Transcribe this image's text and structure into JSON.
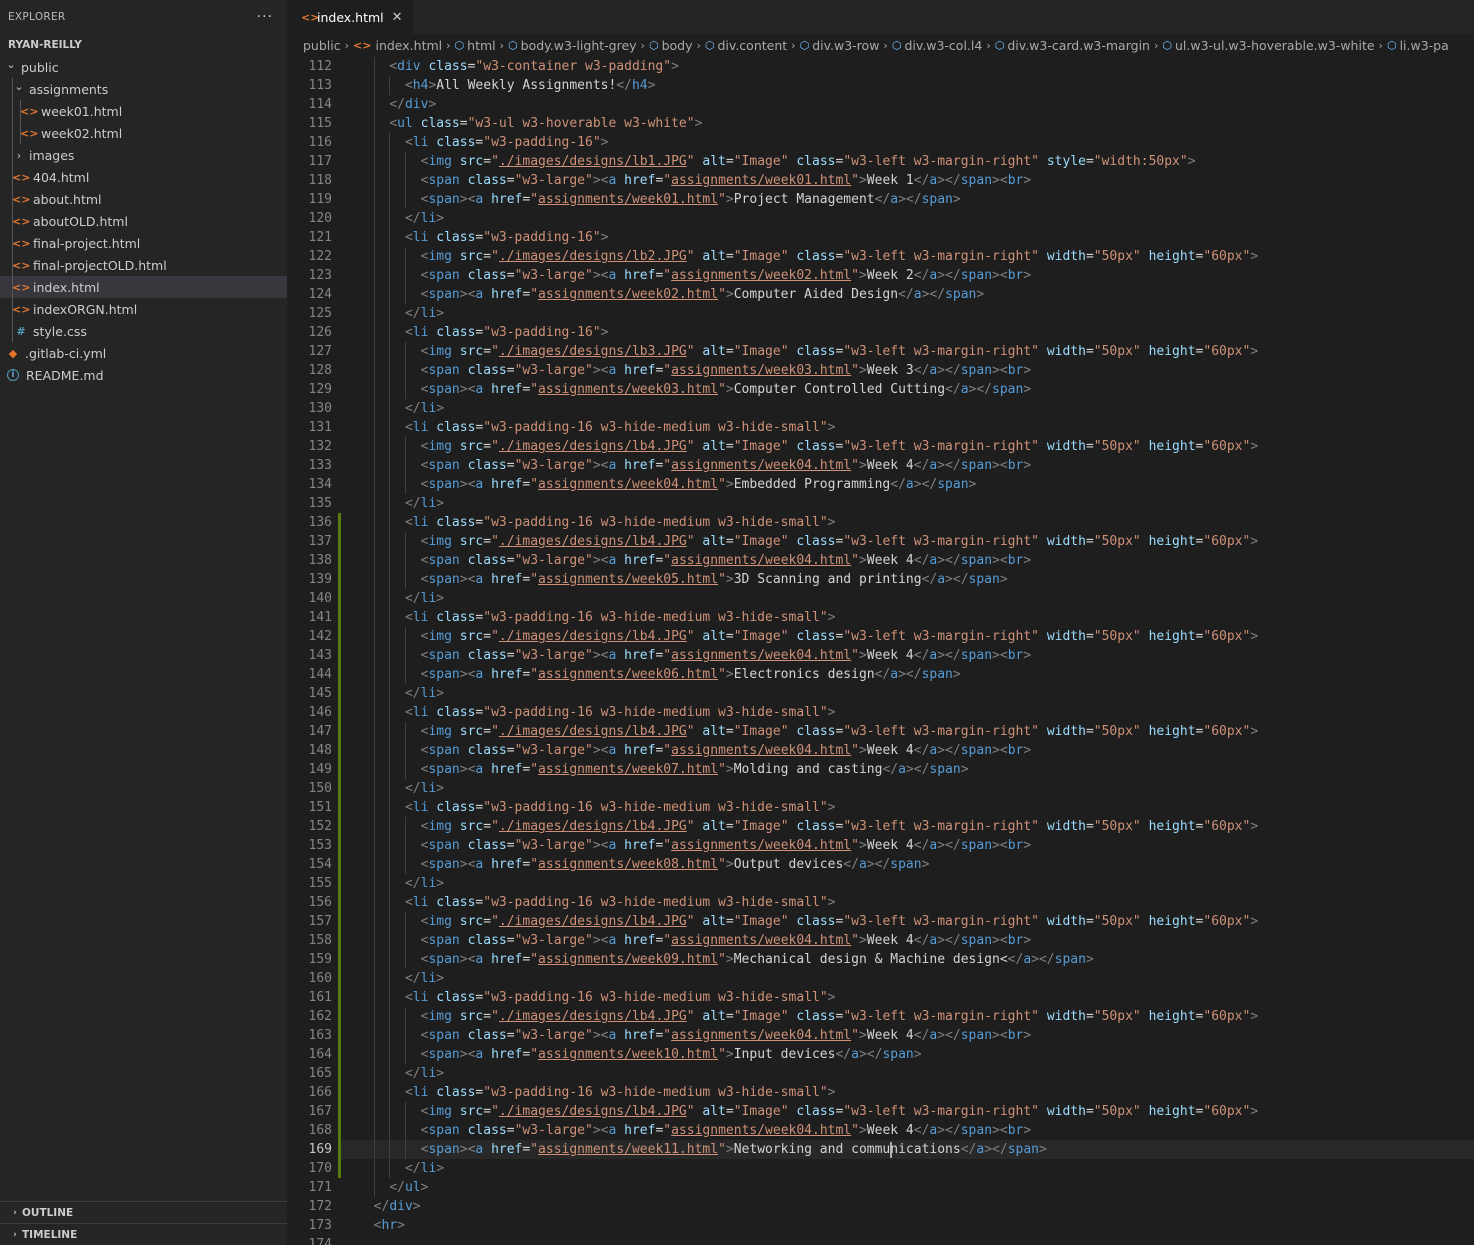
{
  "explorer": {
    "title": "EXPLORER",
    "more": "···",
    "root": "RYAN-REILLY",
    "tree": [
      {
        "label": "public",
        "kind": "folder-open",
        "depth": 0
      },
      {
        "label": "assignments",
        "kind": "folder-open",
        "depth": 1
      },
      {
        "label": "week01.html",
        "kind": "html",
        "depth": 2
      },
      {
        "label": "week02.html",
        "kind": "html",
        "depth": 2
      },
      {
        "label": "images",
        "kind": "folder-closed",
        "depth": 1
      },
      {
        "label": "404.html",
        "kind": "html",
        "depth": 1
      },
      {
        "label": "about.html",
        "kind": "html",
        "depth": 1
      },
      {
        "label": "aboutOLD.html",
        "kind": "html",
        "depth": 1
      },
      {
        "label": "final-project.html",
        "kind": "html",
        "depth": 1
      },
      {
        "label": "final-projectOLD.html",
        "kind": "html",
        "depth": 1
      },
      {
        "label": "index.html",
        "kind": "html",
        "depth": 1,
        "selected": true
      },
      {
        "label": "indexORGN.html",
        "kind": "html",
        "depth": 1
      },
      {
        "label": "style.css",
        "kind": "css",
        "depth": 1
      },
      {
        "label": ".gitlab-ci.yml",
        "kind": "yml",
        "depth": 0
      },
      {
        "label": "README.md",
        "kind": "info",
        "depth": 0
      }
    ],
    "outline": "OUTLINE",
    "timeline": "TIMELINE"
  },
  "tab": {
    "label": "index.html",
    "close": "✕"
  },
  "breadcrumb": [
    {
      "label": "public",
      "icon": "none"
    },
    {
      "label": "index.html",
      "icon": "html"
    },
    {
      "label": "html",
      "icon": "cube"
    },
    {
      "label": "body.w3-light-grey",
      "icon": "cube"
    },
    {
      "label": "body",
      "icon": "cube"
    },
    {
      "label": "div.content",
      "icon": "cube"
    },
    {
      "label": "div.w3-row",
      "icon": "cube"
    },
    {
      "label": "div.w3-col.l4",
      "icon": "cube"
    },
    {
      "label": "div.w3-card.w3-margin",
      "icon": "cube"
    },
    {
      "label": "ul.w3-ul.w3-hoverable.w3-white",
      "icon": "cube"
    },
    {
      "label": "li.w3-pa",
      "icon": "cube"
    }
  ],
  "editor": {
    "current_line": 169,
    "lines": [
      {
        "n": "112",
        "code": "    <div class=\"w3-container w3-padding\">"
      },
      {
        "n": "113",
        "code": "      <h4>All Weekly Assignments!</h4>"
      },
      {
        "n": "114",
        "code": "    </div>"
      },
      {
        "n": "115",
        "code": "    <ul class=\"w3-ul w3-hoverable w3-white\">"
      },
      {
        "n": "116",
        "code": "      <li class=\"w3-padding-16\">"
      },
      {
        "n": "117",
        "code": "        <img src=\"./images/designs/lb1.JPG\" alt=\"Image\" class=\"w3-left w3-margin-right\" style=\"width:50px\">"
      },
      {
        "n": "118",
        "code": "        <span class=\"w3-large\"><a href=\"assignments/week01.html\">Week 1</a></span><br>"
      },
      {
        "n": "119",
        "code": "        <span><a href=\"assignments/week01.html\">Project Management</a></span>"
      },
      {
        "n": "120",
        "code": "      </li>"
      },
      {
        "n": "121",
        "code": "      <li class=\"w3-padding-16\">"
      },
      {
        "n": "122",
        "code": "        <img src=\"./images/designs/lb2.JPG\" alt=\"Image\" class=\"w3-left w3-margin-right\" width=\"50px\" height=\"60px\">"
      },
      {
        "n": "123",
        "code": "        <span class=\"w3-large\"><a href=\"assignments/week02.html\">Week 2</a></span><br>"
      },
      {
        "n": "124",
        "code": "        <span><a href=\"assignments/week02.html\">Computer Aided Design</a></span>"
      },
      {
        "n": "125",
        "code": "      </li>"
      },
      {
        "n": "126",
        "code": "      <li class=\"w3-padding-16\">"
      },
      {
        "n": "127",
        "code": "        <img src=\"./images/designs/lb3.JPG\" alt=\"Image\" class=\"w3-left w3-margin-right\" width=\"50px\" height=\"60px\">"
      },
      {
        "n": "128",
        "code": "        <span class=\"w3-large\"><a href=\"assignments/week03.html\">Week 3</a></span><br>"
      },
      {
        "n": "129",
        "code": "        <span><a href=\"assignments/week03.html\">Computer Controlled Cutting</a></span>"
      },
      {
        "n": "130",
        "code": "      </li>"
      },
      {
        "n": "131",
        "code": "      <li class=\"w3-padding-16 w3-hide-medium w3-hide-small\">"
      },
      {
        "n": "132",
        "code": "        <img src=\"./images/designs/lb4.JPG\" alt=\"Image\" class=\"w3-left w3-margin-right\" width=\"50px\" height=\"60px\">"
      },
      {
        "n": "133",
        "code": "        <span class=\"w3-large\"><a href=\"assignments/week04.html\">Week 4</a></span><br>"
      },
      {
        "n": "134",
        "code": "        <span><a href=\"assignments/week04.html\">Embedded Programming</a></span>"
      },
      {
        "n": "135",
        "code": "      </li>"
      },
      {
        "n": "136",
        "code": "      <li class=\"w3-padding-16 w3-hide-medium w3-hide-small\">",
        "mod": true
      },
      {
        "n": "137",
        "code": "        <img src=\"./images/designs/lb4.JPG\" alt=\"Image\" class=\"w3-left w3-margin-right\" width=\"50px\" height=\"60px\">",
        "mod": true
      },
      {
        "n": "138",
        "code": "        <span class=\"w3-large\"><a href=\"assignments/week04.html\">Week 4</a></span><br>",
        "mod": true
      },
      {
        "n": "139",
        "code": "        <span><a href=\"assignments/week05.html\">3D Scanning and printing</a></span>",
        "mod": true
      },
      {
        "n": "140",
        "code": "      </li>",
        "mod": true
      },
      {
        "n": "141",
        "code": "      <li class=\"w3-padding-16 w3-hide-medium w3-hide-small\">",
        "mod": true
      },
      {
        "n": "142",
        "code": "        <img src=\"./images/designs/lb4.JPG\" alt=\"Image\" class=\"w3-left w3-margin-right\" width=\"50px\" height=\"60px\">",
        "mod": true
      },
      {
        "n": "143",
        "code": "        <span class=\"w3-large\"><a href=\"assignments/week04.html\">Week 4</a></span><br>",
        "mod": true
      },
      {
        "n": "144",
        "code": "        <span><a href=\"assignments/week06.html\">Electronics design</a></span>",
        "mod": true
      },
      {
        "n": "145",
        "code": "      </li>",
        "mod": true
      },
      {
        "n": "146",
        "code": "      <li class=\"w3-padding-16 w3-hide-medium w3-hide-small\">",
        "mod": true
      },
      {
        "n": "147",
        "code": "        <img src=\"./images/designs/lb4.JPG\" alt=\"Image\" class=\"w3-left w3-margin-right\" width=\"50px\" height=\"60px\">",
        "mod": true
      },
      {
        "n": "148",
        "code": "        <span class=\"w3-large\"><a href=\"assignments/week04.html\">Week 4</a></span><br>",
        "mod": true
      },
      {
        "n": "149",
        "code": "        <span><a href=\"assignments/week07.html\">Molding and casting</a></span>",
        "mod": true
      },
      {
        "n": "150",
        "code": "      </li>",
        "mod": true
      },
      {
        "n": "151",
        "code": "      <li class=\"w3-padding-16 w3-hide-medium w3-hide-small\">",
        "mod": true
      },
      {
        "n": "152",
        "code": "        <img src=\"./images/designs/lb4.JPG\" alt=\"Image\" class=\"w3-left w3-margin-right\" width=\"50px\" height=\"60px\">",
        "mod": true
      },
      {
        "n": "153",
        "code": "        <span class=\"w3-large\"><a href=\"assignments/week04.html\">Week 4</a></span><br>",
        "mod": true
      },
      {
        "n": "154",
        "code": "        <span><a href=\"assignments/week08.html\">Output devices</a></span>",
        "mod": true
      },
      {
        "n": "155",
        "code": "      </li>",
        "mod": true
      },
      {
        "n": "156",
        "code": "      <li class=\"w3-padding-16 w3-hide-medium w3-hide-small\">",
        "mod": true
      },
      {
        "n": "157",
        "code": "        <img src=\"./images/designs/lb4.JPG\" alt=\"Image\" class=\"w3-left w3-margin-right\" width=\"50px\" height=\"60px\">",
        "mod": true
      },
      {
        "n": "158",
        "code": "        <span class=\"w3-large\"><a href=\"assignments/week04.html\">Week 4</a></span><br>",
        "mod": true
      },
      {
        "n": "159",
        "code": "        <span><a href=\"assignments/week09.html\">Mechanical design & Machine design<</a></span>",
        "mod": true
      },
      {
        "n": "160",
        "code": "      </li>",
        "mod": true
      },
      {
        "n": "161",
        "code": "      <li class=\"w3-padding-16 w3-hide-medium w3-hide-small\">",
        "mod": true
      },
      {
        "n": "162",
        "code": "        <img src=\"./images/designs/lb4.JPG\" alt=\"Image\" class=\"w3-left w3-margin-right\" width=\"50px\" height=\"60px\">",
        "mod": true
      },
      {
        "n": "163",
        "code": "        <span class=\"w3-large\"><a href=\"assignments/week04.html\">Week 4</a></span><br>",
        "mod": true
      },
      {
        "n": "164",
        "code": "        <span><a href=\"assignments/week10.html\">Input devices</a></span>",
        "mod": true
      },
      {
        "n": "165",
        "code": "      </li>",
        "mod": true
      },
      {
        "n": "166",
        "code": "      <li class=\"w3-padding-16 w3-hide-medium w3-hide-small\">",
        "mod": true
      },
      {
        "n": "167",
        "code": "        <img src=\"./images/designs/lb4.JPG\" alt=\"Image\" class=\"w3-left w3-margin-right\" width=\"50px\" height=\"60px\">",
        "mod": true
      },
      {
        "n": "168",
        "code": "        <span class=\"w3-large\"><a href=\"assignments/week04.html\">Week 4</a></span><br>",
        "mod": true
      },
      {
        "n": "169",
        "code": "        <span><a href=\"assignments/week11.html\">Networking and communications</a></span>",
        "mod": true,
        "cursor_col": 68
      },
      {
        "n": "170",
        "code": "      </li>",
        "mod": true
      },
      {
        "n": "171",
        "code": "    </ul>"
      },
      {
        "n": "172",
        "code": "  </div>"
      },
      {
        "n": "173",
        "code": "  <hr>"
      },
      {
        "n": "174",
        "code": ""
      }
    ]
  },
  "colors": {
    "tag": "#569cd6",
    "attr": "#9cdcfe",
    "string": "#ce9178",
    "punct": "#808080",
    "text": "#d4d4d4",
    "modified": "#587c0c",
    "html_icon": "#e37933"
  }
}
